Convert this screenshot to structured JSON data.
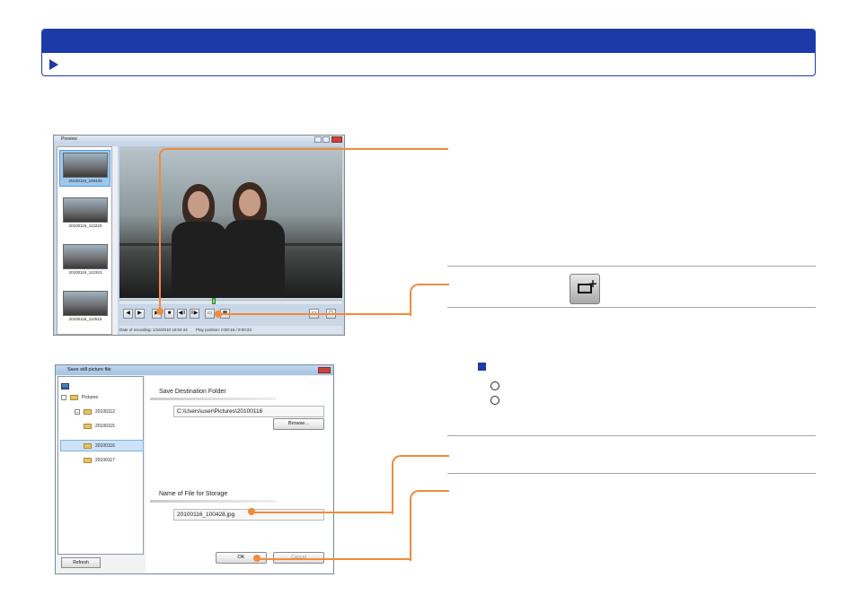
{
  "preview_window": {
    "title": "Preview",
    "thumbnails": [
      {
        "caption": "20100116_100428"
      },
      {
        "caption": "20100116_112223"
      },
      {
        "caption": "20100116_112341"
      },
      {
        "caption": "20100116_112515"
      }
    ],
    "controls": [
      "◀",
      "▶",
      "▶",
      "■",
      "◀II",
      "II▶",
      "▭",
      "▦",
      "▭",
      "◻"
    ],
    "status": {
      "recording": "Date of recording: 1/16/2010 10:04:44",
      "position": "Play position: 0:00:16 / 0:00:23"
    }
  },
  "save_dialog": {
    "title": "Save still picture file",
    "tree": {
      "root": "Pictures",
      "folders": [
        "20100112",
        "20100115",
        "20100116",
        "20100117"
      ],
      "selected": "20100116"
    },
    "refresh_label": "Refresh",
    "destination": {
      "label": "Save Destination Folder",
      "path": "C:\\Users\\user\\Pictures\\20100116",
      "browse_label": "Browse..."
    },
    "filename": {
      "label": "Name of File for Storage",
      "value": "20100116_100428.jpg"
    },
    "ok_label": "OK",
    "cancel_label": "Cancel"
  },
  "colors": {
    "banner": "#1c3aa8",
    "callout": "#f08b3c",
    "bullet": "#1c3aa8"
  },
  "icons": {
    "banner_marker": "play-triangle-icon",
    "snapshot": "capture-still-icon"
  }
}
